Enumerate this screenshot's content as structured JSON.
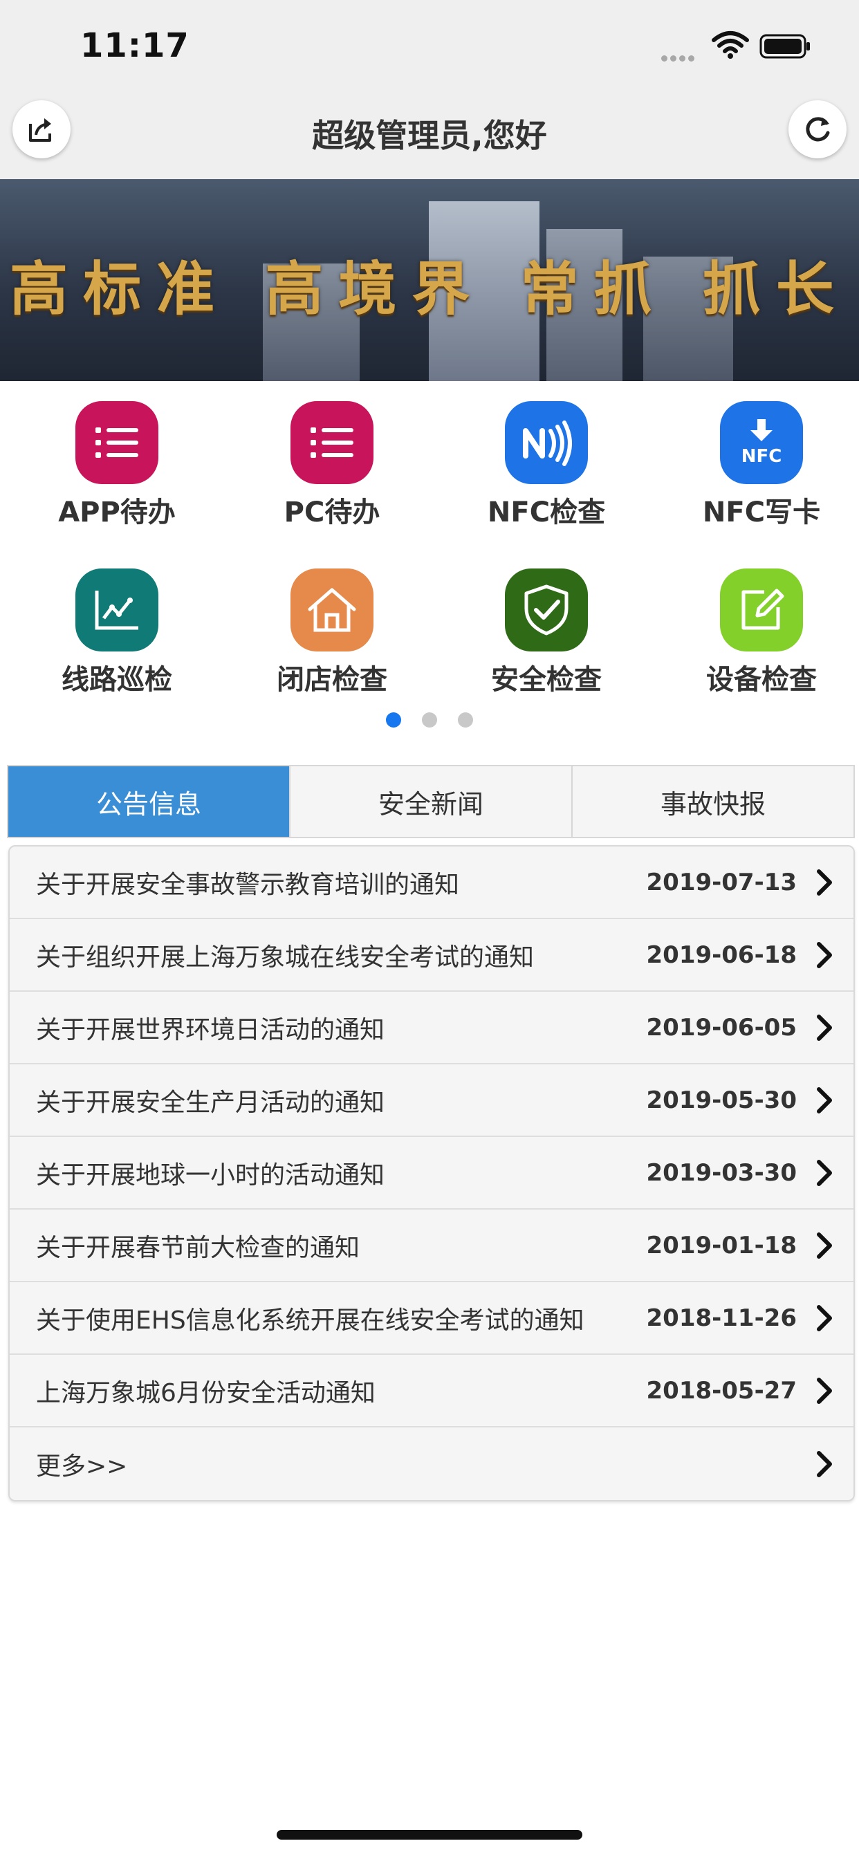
{
  "status_bar": {
    "time": "11:17"
  },
  "header": {
    "title": "超级管理员,您好"
  },
  "banner": {
    "slogan": "高标准 高境界 常抓 抓长"
  },
  "grid_items": [
    {
      "label": "APP待办",
      "icon": "list-icon",
      "color": "#c8145a"
    },
    {
      "label": "PC待办",
      "icon": "list-icon",
      "color": "#c8145a"
    },
    {
      "label": "NFC检查",
      "icon": "nfc-icon",
      "color": "#1e74e6"
    },
    {
      "label": "NFC写卡",
      "icon": "nfc-write-icon",
      "color": "#1e74e6"
    },
    {
      "label": "线路巡检",
      "icon": "chart-line-icon",
      "color": "#0f7a76"
    },
    {
      "label": "闭店检查",
      "icon": "home-icon",
      "color": "#e58a4a"
    },
    {
      "label": "安全检查",
      "icon": "shield-check-icon",
      "color": "#2f6a16"
    },
    {
      "label": "设备检查",
      "icon": "edit-icon",
      "color": "#84d02a"
    }
  ],
  "tabs": [
    {
      "label": "公告信息",
      "active": true
    },
    {
      "label": "安全新闻",
      "active": false
    },
    {
      "label": "事故快报",
      "active": false
    }
  ],
  "news": [
    {
      "title": "关于开展安全事故警示教育培训的通知",
      "date": "2019-07-13"
    },
    {
      "title": "关于组织开展上海万象城在线安全考试的通知",
      "date": "2019-06-18"
    },
    {
      "title": "关于开展世界环境日活动的通知",
      "date": "2019-06-05"
    },
    {
      "title": "关于开展安全生产月活动的通知",
      "date": "2019-05-30"
    },
    {
      "title": "关于开展地球一小时的活动通知",
      "date": "2019-03-30"
    },
    {
      "title": "关于开展春节前大检查的通知",
      "date": "2019-01-18"
    },
    {
      "title": "关于使用EHS信息化系统开展在线安全考试的通知",
      "date": "2018-11-26"
    },
    {
      "title": "上海万象城6月份安全活动通知",
      "date": "2018-05-27"
    },
    {
      "title": "更多>>",
      "date": ""
    }
  ],
  "colors": {
    "accent": "#1677ee",
    "tab_active": "#3a8ed5"
  }
}
